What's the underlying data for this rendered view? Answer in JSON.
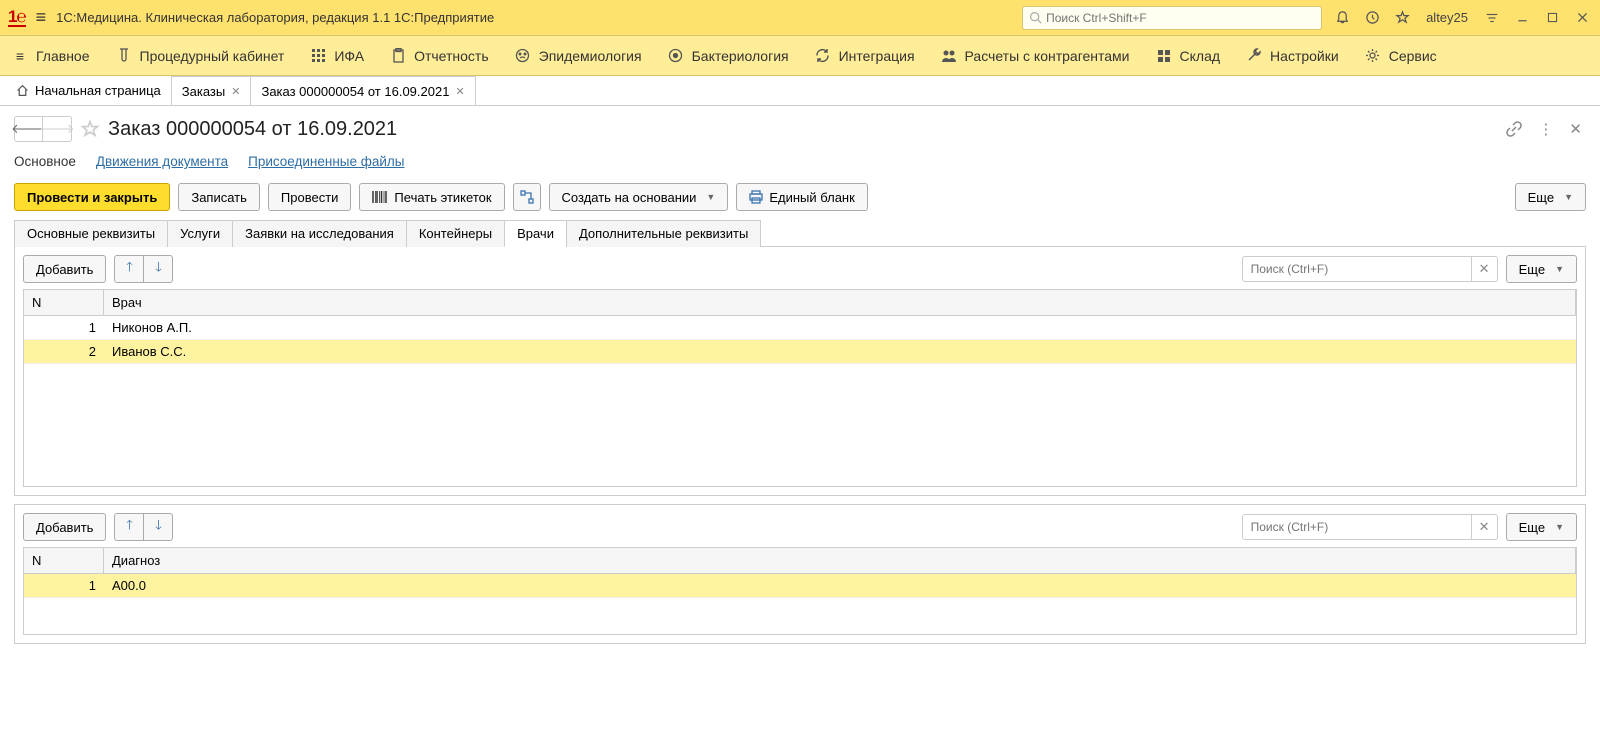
{
  "titlebar": {
    "title": "1С:Медицина. Клиническая лаборатория, редакция 1.1 1С:Предприятие",
    "search_placeholder": "Поиск Ctrl+Shift+F",
    "user": "altey25"
  },
  "menubar": {
    "items": [
      {
        "label": "Главное",
        "icon": "menu"
      },
      {
        "label": "Процедурный кабинет",
        "icon": "tube"
      },
      {
        "label": "ИФА",
        "icon": "plate"
      },
      {
        "label": "Отчетность",
        "icon": "clipboard"
      },
      {
        "label": "Эпидемиология",
        "icon": "face"
      },
      {
        "label": "Бактериология",
        "icon": "target"
      },
      {
        "label": "Интеграция",
        "icon": "sync"
      },
      {
        "label": "Расчеты с контрагентами",
        "icon": "people"
      },
      {
        "label": "Склад",
        "icon": "boxes"
      },
      {
        "label": "Настройки",
        "icon": "wrench"
      },
      {
        "label": "Сервис",
        "icon": "gear"
      }
    ]
  },
  "navtabs": {
    "home": "Начальная страница",
    "tabs": [
      {
        "label": "Заказы"
      },
      {
        "label": "Заказ 000000054 от 16.09.2021"
      }
    ]
  },
  "page_title": "Заказ 000000054 от 16.09.2021",
  "subnav": {
    "main": "Основное",
    "movements": "Движения документа",
    "files": "Присоединенные файлы"
  },
  "actions": {
    "post_close": "Провести и закрыть",
    "write": "Записать",
    "post": "Провести",
    "print_labels": "Печать этикеток",
    "create_based": "Создать на основании",
    "single_form": "Единый бланк",
    "more": "Еще"
  },
  "form_tabs": {
    "items": [
      "Основные реквизиты",
      "Услуги",
      "Заявки на исследования",
      "Контейнеры",
      "Врачи",
      "Дополнительные реквизиты"
    ]
  },
  "table1": {
    "add_label": "Добавить",
    "search_placeholder": "Поиск (Ctrl+F)",
    "more": "Еще",
    "col_n": "N",
    "col_main": "Врач",
    "rows": [
      {
        "n": "1",
        "val": "Никонов А.П."
      },
      {
        "n": "2",
        "val": "Иванов С.С."
      }
    ]
  },
  "table2": {
    "add_label": "Добавить",
    "search_placeholder": "Поиск (Ctrl+F)",
    "more": "Еще",
    "col_n": "N",
    "col_main": "Диагноз",
    "rows": [
      {
        "n": "1",
        "val": "A00.0"
      }
    ]
  }
}
